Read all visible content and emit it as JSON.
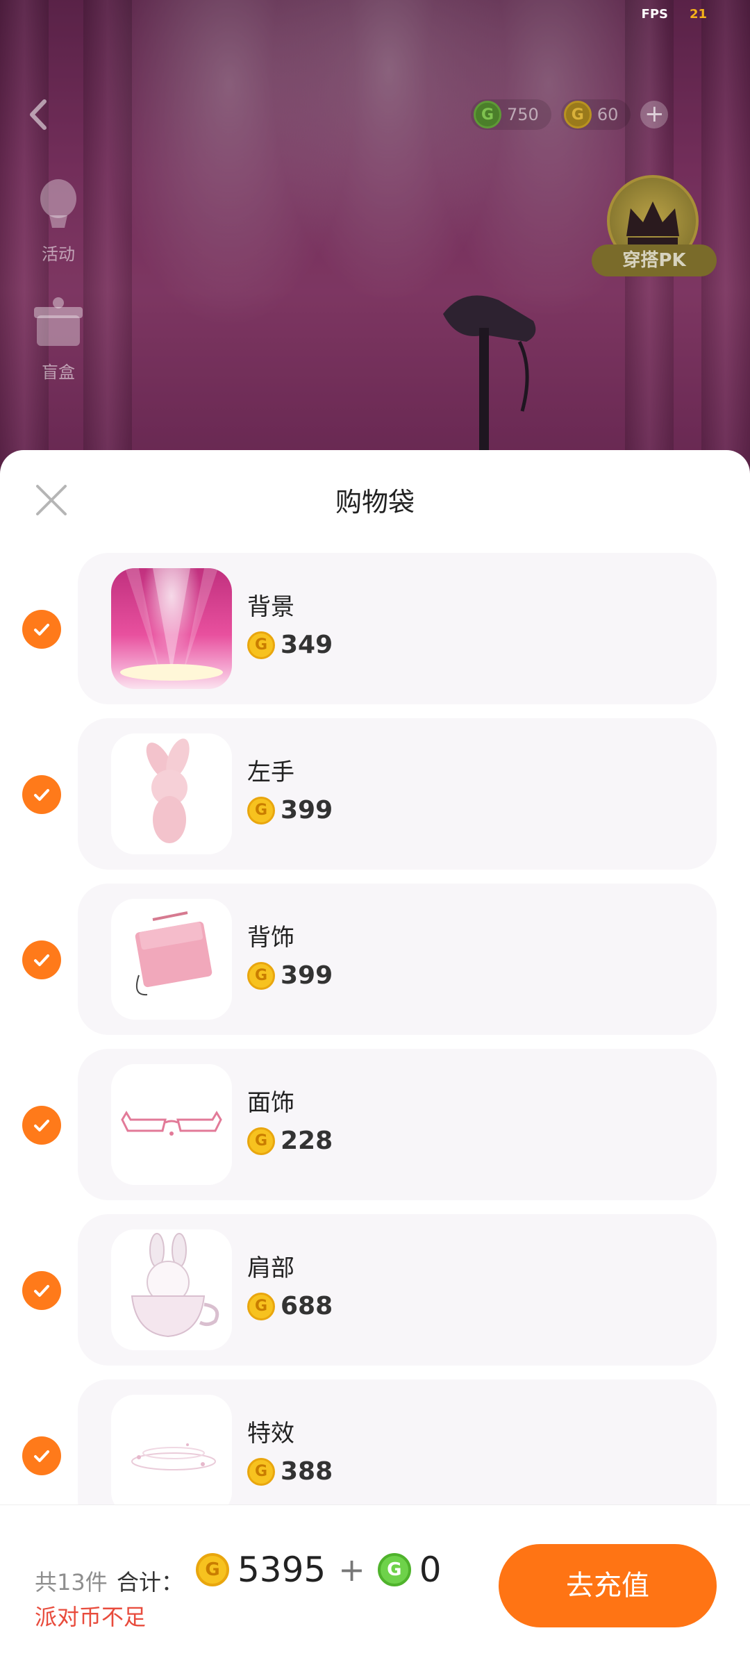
{
  "status": {
    "fps_label": "FPS",
    "fps_value": "21"
  },
  "currency": {
    "party_coins": "750",
    "gold_coins": "60"
  },
  "side_menu": {
    "activity": "活动",
    "blind_box": "盲盒"
  },
  "pk_badge": {
    "label": "穿搭PK"
  },
  "sheet": {
    "title": "购物袋",
    "items": [
      {
        "name": "背景",
        "price": "349",
        "checked": true
      },
      {
        "name": "左手",
        "price": "399",
        "checked": true
      },
      {
        "name": "背饰",
        "price": "399",
        "checked": true
      },
      {
        "name": "面饰",
        "price": "228",
        "checked": true
      },
      {
        "name": "肩部",
        "price": "688",
        "checked": true
      },
      {
        "name": "特效",
        "price": "388",
        "checked": true
      }
    ]
  },
  "footer": {
    "count_text": "共13件",
    "total_label": "合计：",
    "gold_total": "5395",
    "plus": "+",
    "green_total": "0",
    "warning": "派对币不足",
    "recharge_label": "去充值"
  },
  "colors": {
    "accent_orange": "#ff7414",
    "warning_red": "#e84b3c",
    "coin_gold": "#f7c21f",
    "coin_green": "#6ed24a"
  }
}
